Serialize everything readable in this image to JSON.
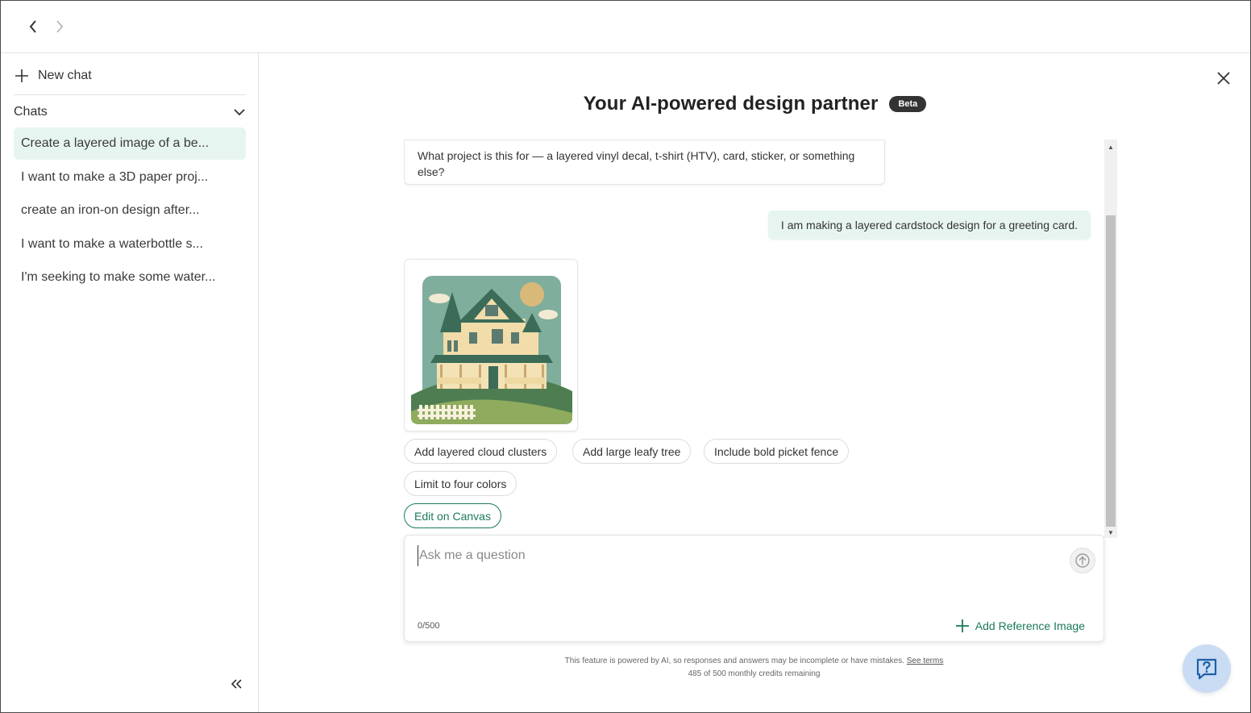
{
  "sidebar": {
    "new_chat_label": "New chat",
    "chats_header": "Chats",
    "chats": [
      "Create a layered image of a be...",
      "I want to make a 3D paper proj...",
      "create an iron-on design after...",
      "I want to make a waterbottle s...",
      "I'm seeking to make some water..."
    ]
  },
  "main": {
    "title": "Your AI-powered design partner",
    "badge": "Beta",
    "bot_message": "What project is this for — a layered vinyl decal, t-shirt (HTV), card, sticker, or something else?",
    "user_message": "I am making a layered cardstock design for a greeting card.",
    "suggestions": [
      "Add layered cloud clusters",
      "Add large leafy tree",
      "Include bold picket fence",
      "Limit to four colors"
    ],
    "edit_canvas_label": "Edit on Canvas",
    "input_placeholder": "Ask me a question",
    "input_value": "",
    "char_count": "0/500",
    "add_reference_label": "Add Reference Image",
    "disclaimer_text": "This feature is powered by AI, so responses and answers may be incomplete or have mistakes.",
    "see_terms_label": "See terms",
    "credits_text": "485 of 500 monthly credits remaining"
  },
  "colors": {
    "accent_green": "#1b7a5a",
    "active_chat_bg": "#e7f5f0",
    "help_fab_bg": "#c9dcf3",
    "beta_badge_bg": "#333333"
  },
  "icons": {
    "back": "chevron-left-icon",
    "forward": "chevron-right-icon",
    "new_chat": "plus-icon",
    "chats_toggle": "chevron-down-icon",
    "collapse_sidebar": "double-chevron-left-icon",
    "close": "close-icon",
    "send": "arrow-up-icon",
    "add_reference": "plus-icon",
    "help": "question-icon"
  }
}
